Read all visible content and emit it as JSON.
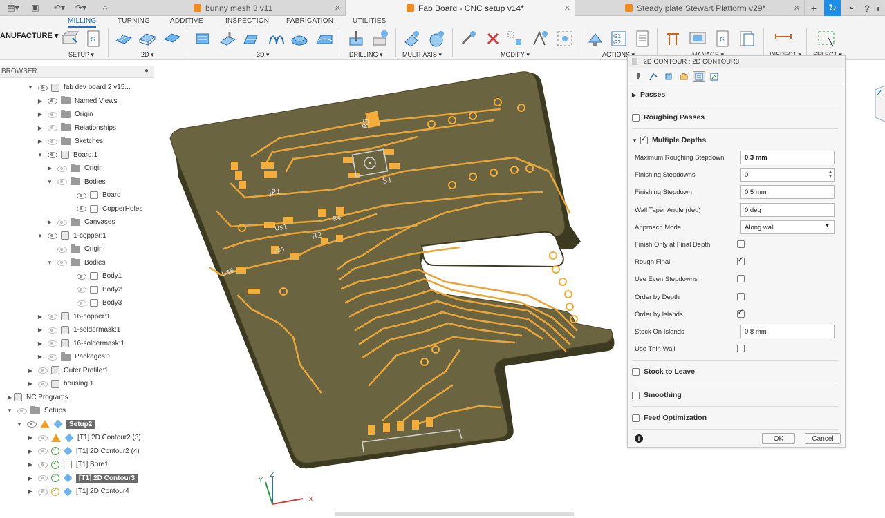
{
  "tabs": [
    {
      "label": "bunny mesh 3 v11",
      "active": false
    },
    {
      "label": "Fab Board - CNC setup v14*",
      "active": true
    },
    {
      "label": "Steady plate Stewart Platform v29*",
      "active": false
    }
  ],
  "ribbon": {
    "workspace": "ANUFACTURE",
    "tabs": [
      "MILLING",
      "TURNING",
      "ADDITIVE",
      "INSPECTION",
      "FABRICATION",
      "UTILITIES"
    ],
    "active_tab": "MILLING",
    "groups": [
      "SETUP ▾",
      "2D ▾",
      "3D ▾",
      "DRILLING ▾",
      "MULTI-AXIS ▾",
      "MODIFY ▾",
      "ACTIONS ▾",
      "MANAGE ▾",
      "INSPECT ▾",
      "SELECT ▾"
    ]
  },
  "browser": {
    "header": "BROWSER",
    "items": [
      {
        "label": "fab dev board 2 v15...",
        "kind": "root"
      },
      {
        "label": "Named Views",
        "kind": "folder"
      },
      {
        "label": "Origin",
        "kind": "folder"
      },
      {
        "label": "Relationships",
        "kind": "folder"
      },
      {
        "label": "Sketches",
        "kind": "folder"
      },
      {
        "label": "Board:1",
        "kind": "component"
      },
      {
        "label": "Origin",
        "kind": "folder"
      },
      {
        "label": "Bodies",
        "kind": "folder"
      },
      {
        "label": "Board",
        "kind": "body"
      },
      {
        "label": "CopperHoles",
        "kind": "body"
      },
      {
        "label": "Canvases",
        "kind": "folder"
      },
      {
        "label": "1-copper:1",
        "kind": "component"
      },
      {
        "label": "Origin",
        "kind": "folder"
      },
      {
        "label": "Bodies",
        "kind": "folder"
      },
      {
        "label": "Body1",
        "kind": "body"
      },
      {
        "label": "Body2",
        "kind": "body"
      },
      {
        "label": "Body3",
        "kind": "body"
      },
      {
        "label": "16-copper:1",
        "kind": "component"
      },
      {
        "label": "1-soldermask:1",
        "kind": "component"
      },
      {
        "label": "16-soldermask:1",
        "kind": "component"
      },
      {
        "label": "Packages:1",
        "kind": "folder"
      },
      {
        "label": "Outer Profile:1",
        "kind": "component"
      },
      {
        "label": "housing:1",
        "kind": "component"
      },
      {
        "label": "NC Programs",
        "kind": "nc"
      },
      {
        "label": "Setups",
        "kind": "setups"
      },
      {
        "label": "Setup2",
        "kind": "setup"
      },
      {
        "label": "[T1] 2D Contour2 (3)",
        "kind": "op-warn"
      },
      {
        "label": "[T1] 2D Contour2 (4)",
        "kind": "op-ok"
      },
      {
        "label": "[T1] Bore1",
        "kind": "op-bore"
      },
      {
        "label": "[T1] 2D Contour3",
        "kind": "op-selected"
      },
      {
        "label": "[T1] 2D Contour4",
        "kind": "op-pending"
      }
    ]
  },
  "viewport": {
    "pcb_labels": [
      "R3",
      "JP1",
      "S1",
      "U$1",
      "R4",
      "R2",
      "U$5",
      "U$6"
    ],
    "axes": {
      "x": "X",
      "y": "Y",
      "z": "Z"
    }
  },
  "dialog": {
    "title": "2D CONTOUR : 2D CONTOUR3",
    "sections": {
      "passes": "Passes",
      "roughing_passes": "Roughing Passes",
      "multiple_depths": "Multiple Depths",
      "stock_to_leave": "Stock to Leave",
      "smoothing": "Smoothing",
      "feed_optimization": "Feed Optimization"
    },
    "fields": {
      "max_roughing_stepdown": {
        "label": "Maximum Roughing Stepdown",
        "value": "0.3 mm"
      },
      "finishing_stepdowns": {
        "label": "Finishing Stepdowns",
        "value": "0"
      },
      "finishing_stepdown": {
        "label": "Finishing Stepdown",
        "value": "0.5 mm"
      },
      "wall_taper_angle": {
        "label": "Wall Taper Angle (deg)",
        "value": "0 deg"
      },
      "approach_mode": {
        "label": "Approach Mode",
        "value": "Along wall"
      },
      "finish_only_final": {
        "label": "Finish Only at Final Depth",
        "checked": false
      },
      "rough_final": {
        "label": "Rough Final",
        "checked": true
      },
      "use_even_stepdowns": {
        "label": "Use Even Stepdowns",
        "checked": false
      },
      "order_by_depth": {
        "label": "Order by Depth",
        "checked": false
      },
      "order_by_islands": {
        "label": "Order by Islands",
        "checked": true
      },
      "stock_on_islands": {
        "label": "Stock On Islands",
        "value": "0.8 mm"
      },
      "use_thin_wall": {
        "label": "Use Thin Wall",
        "checked": false
      }
    },
    "buttons": {
      "ok": "OK",
      "cancel": "Cancel"
    }
  }
}
